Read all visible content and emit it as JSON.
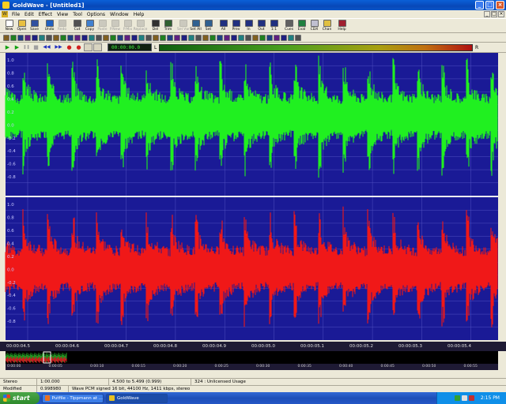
{
  "window": {
    "title": "GoldWave - [Untitled1]",
    "buttons": {
      "minimize": "_",
      "maximize": "□",
      "close": "×"
    }
  },
  "menu": {
    "items": [
      "File",
      "Edit",
      "Effect",
      "View",
      "Tool",
      "Options",
      "Window",
      "Help"
    ]
  },
  "toolbar1": {
    "buttons": [
      {
        "label": "New",
        "icon": "new-file-icon",
        "color": "#ffffff",
        "enabled": true
      },
      {
        "label": "Open",
        "icon": "open-folder-icon",
        "color": "#e8c040",
        "enabled": true
      },
      {
        "label": "Save",
        "icon": "save-disk-icon",
        "color": "#3050a0",
        "enabled": true
      },
      {
        "label": "Undo",
        "icon": "undo-icon",
        "color": "#2060c0",
        "enabled": true
      },
      {
        "label": "Redo",
        "icon": "redo-icon",
        "color": "#808080",
        "enabled": false
      },
      {
        "label": "Cut",
        "icon": "scissors-icon",
        "color": "#505050",
        "enabled": true
      },
      {
        "label": "Copy",
        "icon": "copy-icon",
        "color": "#4080d0",
        "enabled": true
      },
      {
        "label": "Paste",
        "icon": "paste-icon",
        "color": "#909090",
        "enabled": false
      },
      {
        "label": "P.New",
        "icon": "paste-new-icon",
        "color": "#909090",
        "enabled": false
      },
      {
        "label": "P.Mix",
        "icon": "paste-mix-icon",
        "color": "#909090",
        "enabled": false
      },
      {
        "label": "Replace",
        "icon": "replace-icon",
        "color": "#909090",
        "enabled": false
      },
      {
        "label": "Del",
        "icon": "delete-icon",
        "color": "#303030",
        "enabled": true
      },
      {
        "label": "Trim",
        "icon": "trim-icon",
        "color": "#306030",
        "enabled": true
      },
      {
        "label": "Sel Vw",
        "icon": "select-view-icon",
        "color": "#909090",
        "enabled": false
      },
      {
        "label": "Set All",
        "icon": "select-all-icon",
        "color": "#306090",
        "enabled": true
      },
      {
        "label": "Set",
        "icon": "set-icon",
        "color": "#306090",
        "enabled": true
      },
      {
        "label": "All",
        "icon": "zoom-all-icon",
        "color": "#203080",
        "enabled": true
      },
      {
        "label": "Prev",
        "icon": "zoom-prev-icon",
        "color": "#203080",
        "enabled": true
      },
      {
        "label": "In",
        "icon": "zoom-in-icon",
        "color": "#203080",
        "enabled": true
      },
      {
        "label": "Out",
        "icon": "zoom-out-icon",
        "color": "#203080",
        "enabled": true
      },
      {
        "label": "1:1",
        "icon": "zoom-actual-icon",
        "color": "#203080",
        "enabled": true
      },
      {
        "label": "Cues",
        "icon": "cues-icon",
        "color": "#606060",
        "enabled": true
      },
      {
        "label": "Eval",
        "icon": "eval-icon",
        "color": "#208040",
        "enabled": true
      },
      {
        "label": "CDX",
        "icon": "cd-icon",
        "color": "#c0c0d0",
        "enabled": true
      },
      {
        "label": "Chan",
        "icon": "channel-icon",
        "color": "#e0c040",
        "enabled": true
      },
      {
        "label": "Help",
        "icon": "help-book-icon",
        "color": "#a02030",
        "enabled": true
      }
    ]
  },
  "toolbar2": {
    "icons": [
      {
        "icon": "echo-icon",
        "color": "#806020"
      },
      {
        "icon": "equalizer-icon",
        "color": "#208020"
      },
      {
        "icon": "flanger-icon",
        "color": "#204080"
      },
      {
        "icon": "filter-icon",
        "color": "#602080"
      },
      {
        "icon": "dynamics-icon",
        "color": "#202080"
      },
      {
        "icon": "mechanize-icon",
        "color": "#208080"
      },
      {
        "icon": "noise-icon",
        "color": "#505050"
      },
      {
        "icon": "offset-icon",
        "color": "#806020"
      },
      {
        "icon": "pitch-icon",
        "color": "#208020"
      },
      {
        "icon": "playback-rate-icon",
        "color": "#204080"
      },
      {
        "icon": "reverb-icon",
        "color": "#602080"
      },
      {
        "icon": "reverse-icon",
        "color": "#202080"
      },
      {
        "icon": "time-warp-icon",
        "color": "#208080"
      },
      {
        "icon": "resample-icon",
        "color": "#505050"
      },
      {
        "icon": "invert-icon",
        "color": "#806020"
      },
      {
        "icon": "volume-icon",
        "color": "#208020"
      },
      {
        "icon": "fade-in-icon",
        "color": "#204080"
      },
      {
        "icon": "fade-out-icon",
        "color": "#602080"
      },
      {
        "icon": "volume-shape-icon",
        "color": "#202080"
      },
      {
        "icon": "maximize-volume-icon",
        "color": "#208080"
      },
      {
        "icon": "match-volume-icon",
        "color": "#505050"
      },
      {
        "icon": "change-volume-icon",
        "color": "#806020"
      },
      {
        "icon": "pan-icon",
        "color": "#208020"
      },
      {
        "icon": "stereo-icon",
        "color": "#204080"
      },
      {
        "icon": "mono-icon",
        "color": "#602080"
      },
      {
        "icon": "channel-mixer-icon",
        "color": "#202080"
      },
      {
        "icon": "doppler-icon",
        "color": "#208080"
      },
      {
        "icon": "silence-icon",
        "color": "#505050"
      },
      {
        "icon": "compressor-icon",
        "color": "#806020"
      },
      {
        "icon": "noise-reduction-icon",
        "color": "#208020"
      },
      {
        "icon": "pop-click-icon",
        "color": "#204080"
      },
      {
        "icon": "smoother-icon",
        "color": "#602080"
      },
      {
        "icon": "spectrum-filter-icon",
        "color": "#202080"
      },
      {
        "icon": "parametric-eq-icon",
        "color": "#208080"
      },
      {
        "icon": "bandpass-icon",
        "color": "#505050"
      },
      {
        "icon": "lowpass-icon",
        "color": "#806020"
      },
      {
        "icon": "highpass-icon",
        "color": "#208020"
      },
      {
        "icon": "notch-icon",
        "color": "#204080"
      },
      {
        "icon": "graph-icon",
        "color": "#602080"
      },
      {
        "icon": "shape-icon",
        "color": "#202080"
      },
      {
        "icon": "wave-icon",
        "color": "#208080"
      },
      {
        "icon": "interpolate-icon",
        "color": "#505050"
      }
    ]
  },
  "transport": {
    "play": "▶",
    "play_sel": "▶",
    "pause": "❚❚",
    "stop": "■",
    "rewind": "◀◀",
    "forward": "▶▶",
    "record": "●",
    "record_sel": "●",
    "time": "00:00:00.0",
    "level_label": "L",
    "r_label": "R"
  },
  "waveform": {
    "colors": {
      "background": "#1a1a96",
      "left_channel": "#20f020",
      "right_channel": "#f01818",
      "gridline": "#5050c0",
      "divider": "#f0f0f0"
    },
    "scale_labels": [
      "1.0",
      "0.8",
      "0.6",
      "0.4",
      "0.2",
      "0.0",
      "-0.2",
      "-0.4",
      "-0.6",
      "-0.8"
    ]
  },
  "timeline": {
    "ticks": [
      "00:00:04.5",
      "00:00:04.6",
      "00:00:04.7",
      "00:00:04.8",
      "00:00:04.9",
      "00:00:05.0",
      "00:00:05.1",
      "00:00:05.2",
      "00:00:05.3",
      "00:00:05.4"
    ]
  },
  "overview": {
    "ticks": [
      "0:00:00",
      "0:00:05",
      "0:00:10",
      "0:00:15",
      "0:00:20",
      "0:00:25",
      "0:00:30",
      "0:00:35",
      "0:00:40",
      "0:00:45",
      "0:00:50",
      "0:00:55"
    ]
  },
  "status": {
    "row1": [
      "Stereo",
      "1:00.000",
      "4.500 to 5.499 (0.999)",
      "324 : Unlicensed Usage"
    ],
    "row2": [
      "Modified",
      "0.998980",
      "Wave PCM signed 16 bit, 44100 Hz, 1411 kbps, stereo"
    ]
  },
  "taskbar": {
    "start": "start",
    "tasks": [
      {
        "label": "Putfile - Tippmann at ...",
        "icon": "firefox-icon",
        "active": false
      },
      {
        "label": "GoldWave",
        "icon": "goldwave-icon",
        "active": true
      }
    ],
    "clock": "2:15 PM"
  }
}
